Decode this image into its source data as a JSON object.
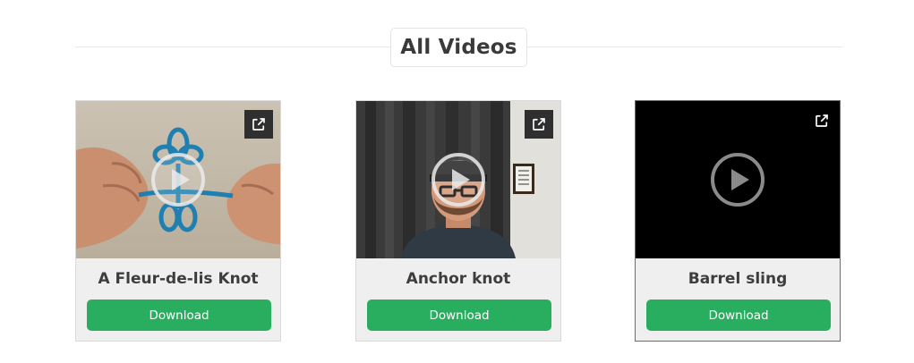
{
  "section": {
    "title": "All Videos"
  },
  "videos": [
    {
      "title": "A Fleur-de-lis Knot",
      "download_label": "Download",
      "external_icon": "external-link-icon",
      "play_icon": "play-icon"
    },
    {
      "title": "Anchor knot",
      "download_label": "Download",
      "external_icon": "external-link-icon",
      "play_icon": "play-icon"
    },
    {
      "title": "Barrel sling",
      "download_label": "Download",
      "external_icon": "external-link-icon",
      "play_icon": "play-icon"
    }
  ],
  "colors": {
    "download_button": "#29ae5f",
    "title_text": "#3a3a3a",
    "card_bg": "#efefef"
  }
}
